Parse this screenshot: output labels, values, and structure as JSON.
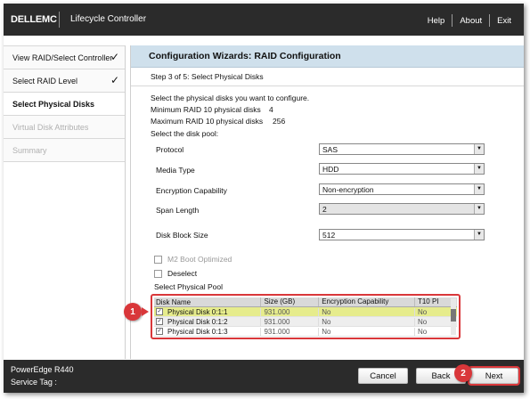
{
  "header": {
    "brand": "DELLEMC",
    "product": "Lifecycle Controller",
    "links": [
      "Help",
      "About",
      "Exit"
    ]
  },
  "sidebar": {
    "items": [
      {
        "label": "View RAID/Select Controller",
        "state": "completed"
      },
      {
        "label": "Select RAID Level",
        "state": "completed"
      },
      {
        "label": "Select Physical Disks",
        "state": "active"
      },
      {
        "label": "Virtual Disk Attributes",
        "state": "disabled"
      },
      {
        "label": "Summary",
        "state": "disabled"
      }
    ],
    "check_glyph": "✓"
  },
  "main": {
    "title": "Configuration Wizards: RAID Configuration",
    "step": "Step 3 of 5: Select Physical Disks",
    "instruction": "Select the physical disks you want to configure.",
    "min_label": "Minimum RAID 10 physical disks",
    "min_value": "4",
    "max_label": "Maximum RAID 10 physical disks",
    "max_value": "256",
    "pool_prompt": "Select the disk pool:",
    "fields": {
      "protocol": {
        "label": "Protocol",
        "value": "SAS"
      },
      "media_type": {
        "label": "Media Type",
        "value": "HDD"
      },
      "encryption": {
        "label": "Encryption Capability",
        "value": "Non-encryption"
      },
      "span_length": {
        "label": "Span Length",
        "value": "2"
      },
      "block_size": {
        "label": "Disk Block Size",
        "value": "512"
      }
    },
    "m2_boot_label": "M2 Boot Optimized",
    "deselect_label": "Deselect",
    "physical_pool_label": "Select Physical Pool",
    "table": {
      "headers": [
        "Disk Name",
        "Size (GB)",
        "Encryption Capability",
        "T10 PI"
      ],
      "rows": [
        {
          "name": "Physical Disk 0:1:1",
          "size": "931.000",
          "encryption": "No",
          "t10": "No"
        },
        {
          "name": "Physical Disk 0:1:2",
          "size": "931.000",
          "encryption": "No",
          "t10": "No"
        },
        {
          "name": "Physical Disk 0:1:3",
          "size": "931.000",
          "encryption": "No",
          "t10": "No"
        }
      ]
    }
  },
  "callouts": {
    "one": "1",
    "two": "2"
  },
  "footer": {
    "model": "PowerEdge R440",
    "service_tag": "Service Tag :",
    "cancel": "Cancel",
    "back": "Back",
    "next": "Next"
  },
  "colors": {
    "header_bg": "#2b2b2b",
    "title_bg": "#cfe0ec",
    "selected_row": "#e6ec8c",
    "callout": "#d9373a"
  }
}
